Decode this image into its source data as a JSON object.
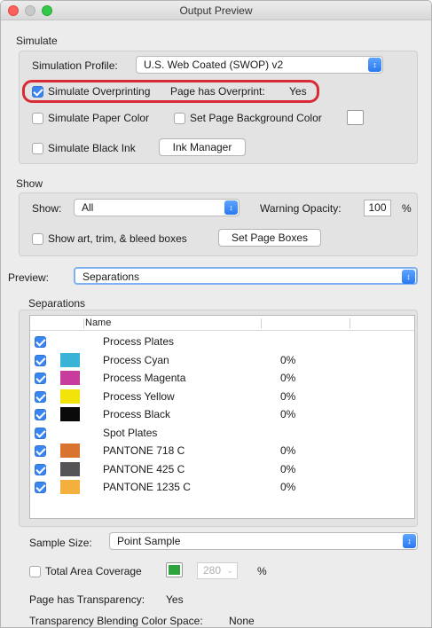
{
  "window": {
    "title": "Output Preview"
  },
  "simulate": {
    "group_label": "Simulate",
    "profile_label": "Simulation Profile:",
    "profile_value": "U.S. Web Coated (SWOP) v2",
    "overprinting_label": "Simulate Overprinting",
    "overprinting_checked": true,
    "overprint_status_label": "Page has Overprint:",
    "overprint_status_value": "Yes",
    "paper_color_label": "Simulate Paper Color",
    "page_bg_label": "Set Page Background Color",
    "black_ink_label": "Simulate Black Ink",
    "ink_manager_label": "Ink Manager"
  },
  "show": {
    "group_label": "Show",
    "show_label": "Show:",
    "show_value": "All",
    "opacity_label": "Warning Opacity:",
    "opacity_value": "100",
    "opacity_unit": "%",
    "boxes_label": "Show art, trim, & bleed boxes",
    "page_boxes_button": "Set Page Boxes"
  },
  "preview": {
    "label": "Preview:",
    "value": "Separations"
  },
  "separations": {
    "group_label": "Separations",
    "col_name": "Name",
    "rows": [
      {
        "name": "Process Plates",
        "color": "",
        "pct": "",
        "checked": true
      },
      {
        "name": "Process Cyan",
        "color": "#3ab4d6",
        "pct": "0%",
        "checked": true
      },
      {
        "name": "Process Magenta",
        "color": "#c83c9e",
        "pct": "0%",
        "checked": true
      },
      {
        "name": "Process Yellow",
        "color": "#f2e40a",
        "pct": "0%",
        "checked": true
      },
      {
        "name": "Process Black",
        "color": "#0a0a0a",
        "pct": "0%",
        "checked": true
      },
      {
        "name": "Spot Plates",
        "color": "",
        "pct": "",
        "checked": true
      },
      {
        "name": "PANTONE 718 C",
        "color": "#d87430",
        "pct": "0%",
        "checked": true
      },
      {
        "name": "PANTONE 425 C",
        "color": "#555557",
        "pct": "0%",
        "checked": true
      },
      {
        "name": "PANTONE 1235 C",
        "color": "#f4b03c",
        "pct": "0%",
        "checked": true
      }
    ]
  },
  "sample": {
    "label": "Sample Size:",
    "value": "Point Sample"
  },
  "coverage": {
    "label": "Total Area Coverage",
    "swatch_color": "#2fa43c",
    "value": "280",
    "unit": "%"
  },
  "transparency": {
    "label": "Page has Transparency:",
    "value": "Yes",
    "blend_label": "Transparency Blending Color Space:",
    "blend_value": "None"
  }
}
